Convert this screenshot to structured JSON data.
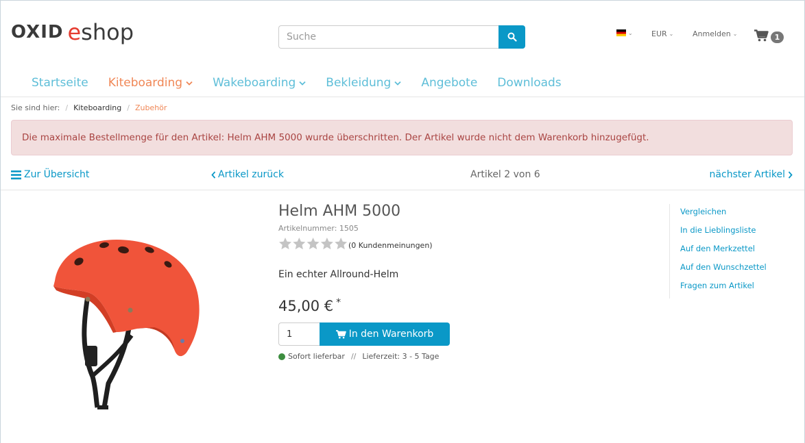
{
  "header": {
    "logo": {
      "part1": "OXID",
      "part2": "e",
      "part3": "shop"
    },
    "search": {
      "placeholder": "Suche"
    },
    "currency": "EUR",
    "login": "Anmelden",
    "cart_count": "1"
  },
  "nav": {
    "items": [
      {
        "label": "Startseite",
        "dropdown": false,
        "active": false
      },
      {
        "label": "Kiteboarding",
        "dropdown": true,
        "active": true
      },
      {
        "label": "Wakeboarding",
        "dropdown": true,
        "active": false
      },
      {
        "label": "Bekleidung",
        "dropdown": true,
        "active": false
      },
      {
        "label": "Angebote",
        "dropdown": false,
        "active": false
      },
      {
        "label": "Downloads",
        "dropdown": false,
        "active": false
      }
    ]
  },
  "breadcrumb": {
    "label": "Sie sind hier:",
    "items": [
      "Kiteboarding",
      "Zubehör"
    ]
  },
  "alert": {
    "message": "Die maximale Bestellmenge für den Artikel: Helm AHM 5000 wurde überschritten. Der Artikel wurde nicht dem Warenkorb hinzugefügt."
  },
  "pager": {
    "back": "Zur Übersicht",
    "prev": "Artikel zurück",
    "count": "Artikel 2 von 6",
    "next": "nächster Artikel"
  },
  "product": {
    "title": "Helm AHM 5000",
    "artnr": "Artikelnummer: 1505",
    "rating": 0,
    "reviews": "(0 Kundenmeinungen)",
    "description": "Ein echter Allround-Helm",
    "price": "45,00 €",
    "price_note": "*",
    "quantity": "1",
    "to_cart": "In den Warenkorb",
    "stock": "Sofort lieferbar",
    "delivery": "Lieferzeit: 3 - 5 Tage"
  },
  "side_actions": [
    "Vergleichen",
    "In die Lieblingsliste",
    "Auf den Merkzettel",
    "Auf den Wunschzettel",
    "Fragen zum Artikel"
  ],
  "colors": {
    "accent": "#0a98c7",
    "nav_link": "#5ebed8",
    "nav_active": "#f08756",
    "alert_bg": "#f2dede",
    "alert_text": "#a94442",
    "helmet": "#f0543a"
  }
}
